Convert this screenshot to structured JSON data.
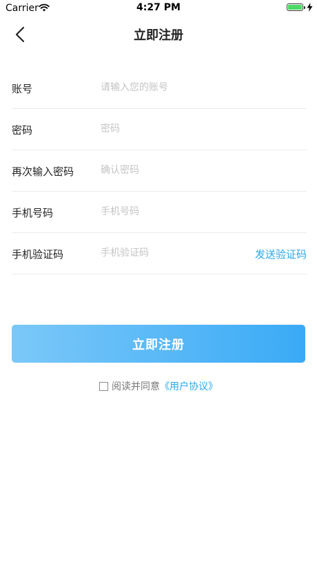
{
  "status_bar": {
    "carrier": "Carrier",
    "time": "4:27 PM",
    "battery_level": 1.0,
    "battery_color": "#4cd964"
  },
  "nav": {
    "back_icon": "chevron-left-icon",
    "title": "立即注册"
  },
  "form": {
    "rows": [
      {
        "label": "账号",
        "placeholder": "请输入您的账号",
        "value": ""
      },
      {
        "label": "密码",
        "placeholder": "密码",
        "value": ""
      },
      {
        "label": "再次输入密码",
        "placeholder": "确认密码",
        "value": ""
      },
      {
        "label": "手机号码",
        "placeholder": "手机号码",
        "value": ""
      },
      {
        "label": "手机验证码",
        "placeholder": "手机验证码",
        "value": ""
      }
    ],
    "send_code_label": "发送验证码"
  },
  "submit": {
    "label": "立即注册"
  },
  "agreement": {
    "checked": false,
    "text": "阅读并同意",
    "link": "《用户协议》"
  },
  "colors": {
    "accent": "#29a8ea",
    "button_gradient_start": "#7bc8f8",
    "button_gradient_end": "#3aaaf6"
  }
}
